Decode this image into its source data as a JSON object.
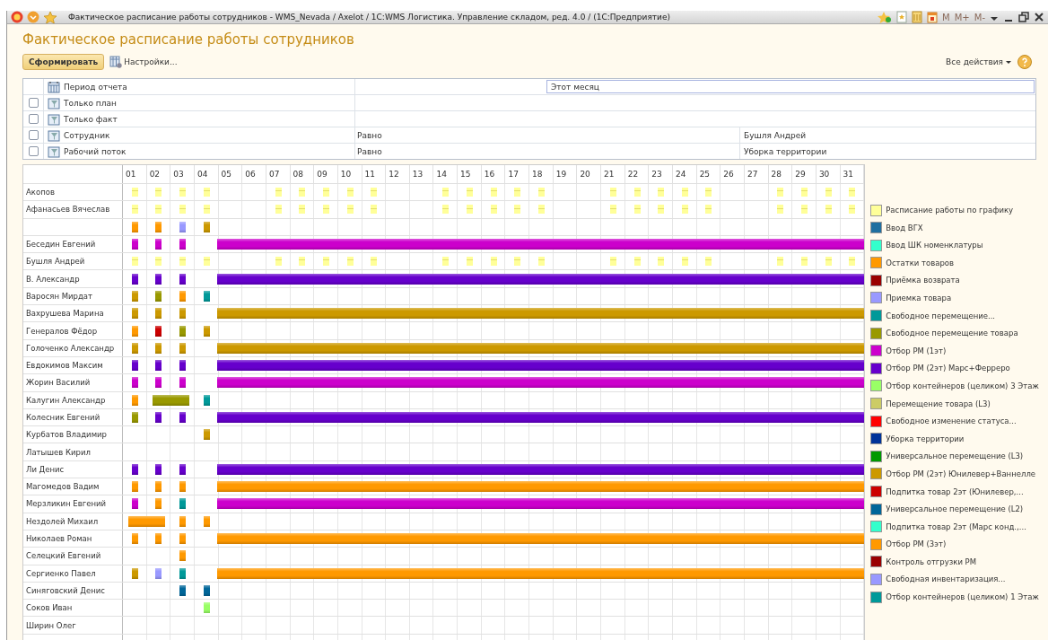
{
  "title_bar": {
    "title": "Фактическое расписание работы сотрудников - WMS_Nevada / Axelot /  1С:WMS Логистика. Управление складом, ред. 4.0 /  (1С:Предприятие)",
    "memory_keys": [
      "M",
      "M+",
      "M-"
    ]
  },
  "heading": "Фактическое расписание работы сотрудников",
  "toolbar": {
    "primary_button": "Сформировать",
    "settings_button": "Настройки...",
    "all_actions": "Все действия"
  },
  "filters": [
    {
      "label": "Период отчета",
      "kind": "period",
      "value": "Этот месяц"
    },
    {
      "label": "Только план",
      "kind": "flag",
      "checked": false
    },
    {
      "label": "Только факт",
      "kind": "flag",
      "checked": false
    },
    {
      "label": "Сотрудник",
      "kind": "condition",
      "checked": false,
      "condition": "Равно",
      "value": "Бушля Андрей"
    },
    {
      "label": "Рабочий поток",
      "kind": "condition",
      "checked": false,
      "condition": "Равно",
      "value": "Уборка территории"
    }
  ],
  "timeline": {
    "days": [
      "01",
      "02",
      "03",
      "04",
      "05",
      "06",
      "07",
      "08",
      "09",
      "10",
      "11",
      "12",
      "13",
      "14",
      "15",
      "16",
      "17",
      "18",
      "19",
      "20",
      "21",
      "22",
      "23",
      "24",
      "25",
      "26",
      "27",
      "28",
      "29",
      "30",
      "31"
    ],
    "rows": [
      {
        "name": "Акопов",
        "kind": "plan",
        "cells": [
          {
            "color": "#ffff99",
            "kind": "block"
          },
          {
            "color": "#ffff99",
            "kind": "block"
          },
          {
            "color": "#ffff99",
            "kind": "block"
          },
          {
            "color": "#ffff99",
            "kind": "block"
          },
          null,
          null,
          {
            "color": "#ffff99",
            "kind": "block"
          },
          {
            "color": "#ffff99",
            "kind": "block"
          },
          {
            "color": "#ffff99",
            "kind": "block"
          },
          {
            "color": "#ffff99",
            "kind": "block"
          },
          {
            "color": "#ffff99",
            "kind": "block"
          },
          null,
          null,
          {
            "color": "#ffff99",
            "kind": "block"
          },
          {
            "color": "#ffff99",
            "kind": "block"
          },
          {
            "color": "#ffff99",
            "kind": "block"
          },
          {
            "color": "#ffff99",
            "kind": "block"
          },
          {
            "color": "#ffff99",
            "kind": "block"
          },
          null,
          null,
          {
            "color": "#ffff99",
            "kind": "block"
          },
          {
            "color": "#ffff99",
            "kind": "block"
          },
          {
            "color": "#ffff99",
            "kind": "block"
          },
          {
            "color": "#ffff99",
            "kind": "block"
          },
          {
            "color": "#ffff99",
            "kind": "block"
          },
          null,
          null,
          {
            "color": "#ffff99",
            "kind": "block"
          },
          {
            "color": "#ffff99",
            "kind": "block"
          },
          {
            "color": "#ffff99",
            "kind": "block"
          },
          {
            "color": "#ffff99",
            "kind": "block"
          }
        ]
      },
      {
        "name": "Афанасьев Вячеслав",
        "kind": "plan",
        "cells": [
          {
            "color": "#ffff99",
            "kind": "block"
          },
          {
            "color": "#ffff99",
            "kind": "block"
          },
          {
            "color": "#ffff99",
            "kind": "block"
          },
          {
            "color": "#ffff99",
            "kind": "block"
          },
          null,
          null,
          {
            "color": "#ffff99",
            "kind": "block"
          },
          {
            "color": "#ffff99",
            "kind": "block"
          },
          {
            "color": "#ffff99",
            "kind": "block"
          },
          {
            "color": "#ffff99",
            "kind": "block"
          },
          {
            "color": "#ffff99",
            "kind": "block"
          },
          null,
          null,
          {
            "color": "#ffff99",
            "kind": "block"
          },
          {
            "color": "#ffff99",
            "kind": "block"
          },
          {
            "color": "#ffff99",
            "kind": "block"
          },
          {
            "color": "#ffff99",
            "kind": "block"
          },
          {
            "color": "#ffff99",
            "kind": "block"
          },
          null,
          null,
          {
            "color": "#ffff99",
            "kind": "block"
          },
          {
            "color": "#ffff99",
            "kind": "block"
          },
          {
            "color": "#ffff99",
            "kind": "block"
          },
          {
            "color": "#ffff99",
            "kind": "block"
          },
          {
            "color": "#ffff99",
            "kind": "block"
          },
          null,
          null,
          {
            "color": "#ffff99",
            "kind": "block"
          },
          {
            "color": "#ffff99",
            "kind": "block"
          },
          {
            "color": "#ffff99",
            "kind": "block"
          },
          {
            "color": "#ffff99",
            "kind": "block"
          }
        ]
      },
      {
        "kind": "fact",
        "cells": [
          {
            "color": "#ff9900",
            "kind": "block"
          },
          {
            "color": "#ff9900",
            "kind": "block"
          },
          {
            "color": "#9999ff",
            "kind": "block"
          },
          {
            "color": "#cc9900",
            "kind": "block"
          }
        ]
      },
      {
        "name": "Беседин Евгений",
        "kind": "fact",
        "cells": [
          {
            "color": "#cc00cc",
            "kind": "block"
          },
          {
            "color": "#cc00cc",
            "kind": "block"
          },
          {
            "color": "#cc00cc",
            "kind": "block"
          },
          null,
          {
            "color": "#cc00cc",
            "kind": "to_month_end"
          }
        ]
      },
      {
        "name": "Бушля Андрей",
        "kind": "plan",
        "cells": [
          {
            "color": "#ffff99",
            "kind": "block"
          },
          {
            "color": "#ffff99",
            "kind": "block"
          },
          {
            "color": "#ffff99",
            "kind": "block"
          },
          {
            "color": "#ffff99",
            "kind": "block"
          },
          null,
          null,
          {
            "color": "#ffff99",
            "kind": "block"
          },
          {
            "color": "#ffff99",
            "kind": "block"
          },
          {
            "color": "#ffff99",
            "kind": "block"
          },
          {
            "color": "#ffff99",
            "kind": "block"
          },
          {
            "color": "#ffff99",
            "kind": "block"
          },
          null,
          null,
          {
            "color": "#ffff99",
            "kind": "block"
          },
          {
            "color": "#ffff99",
            "kind": "block"
          },
          {
            "color": "#ffff99",
            "kind": "block"
          },
          {
            "color": "#ffff99",
            "kind": "block"
          },
          {
            "color": "#ffff99",
            "kind": "block"
          },
          null,
          null,
          {
            "color": "#ffff99",
            "kind": "block"
          },
          {
            "color": "#ffff99",
            "kind": "block"
          },
          {
            "color": "#ffff99",
            "kind": "block"
          },
          {
            "color": "#ffff99",
            "kind": "block"
          },
          {
            "color": "#ffff99",
            "kind": "block"
          },
          null,
          null,
          {
            "color": "#ffff99",
            "kind": "block"
          },
          {
            "color": "#ffff99",
            "kind": "block"
          },
          {
            "color": "#ffff99",
            "kind": "block"
          },
          {
            "color": "#ffff99",
            "kind": "block"
          }
        ]
      },
      {
        "name": "В. Александр",
        "kind": "fact",
        "cells": [
          {
            "color": "#6600cc",
            "kind": "block"
          },
          {
            "color": "#6600cc",
            "kind": "block"
          },
          {
            "color": "#6600cc",
            "kind": "block"
          },
          null,
          {
            "color": "#6600cc",
            "kind": "to_month_end"
          }
        ]
      },
      {
        "name": "Варосян Мирдат",
        "kind": "fact",
        "cells": [
          {
            "color": "#cc9900",
            "kind": "block"
          },
          {
            "color": "#999900",
            "kind": "block"
          },
          {
            "color": "#ff9900",
            "kind": "block"
          },
          {
            "color": "#009999",
            "kind": "block"
          }
        ]
      },
      {
        "name": "Вахрушева Марина",
        "kind": "fact",
        "cells": [
          {
            "color": "#cc9900",
            "kind": "block"
          },
          {
            "color": "#cc9900",
            "kind": "block"
          },
          {
            "color": "#cc9900",
            "kind": "block"
          },
          null,
          {
            "color": "#cc9900",
            "kind": "to_month_end"
          }
        ]
      },
      {
        "name": "Генералов Фёдор",
        "kind": "fact",
        "cells": [
          {
            "color": "#ff9900",
            "kind": "block"
          },
          {
            "color": "#cc0000",
            "kind": "block"
          },
          {
            "color": "#999900",
            "kind": "block"
          },
          {
            "color": "#cc9900",
            "kind": "block"
          }
        ]
      },
      {
        "name": "Голоченко Александр",
        "kind": "fact",
        "cells": [
          {
            "color": "#cc9900",
            "kind": "block"
          },
          {
            "color": "#cc9900",
            "kind": "block"
          },
          {
            "color": "#cc9900",
            "kind": "block"
          },
          null,
          {
            "color": "#cc9900",
            "kind": "to_month_end"
          }
        ]
      },
      {
        "name": "Евдокимов Максим",
        "kind": "fact",
        "cells": [
          {
            "color": "#6600cc",
            "kind": "block"
          },
          {
            "color": "#6600cc",
            "kind": "block"
          },
          {
            "color": "#6600cc",
            "kind": "block"
          },
          null,
          {
            "color": "#6600cc",
            "kind": "to_month_end"
          }
        ]
      },
      {
        "name": "Жорин Василий",
        "kind": "fact",
        "cells": [
          {
            "color": "#cc00cc",
            "kind": "block"
          },
          {
            "color": "#cc00cc",
            "kind": "block"
          },
          {
            "color": "#cc00cc",
            "kind": "block"
          },
          null,
          {
            "color": "#cc00cc",
            "kind": "to_month_end"
          }
        ]
      },
      {
        "name": "Калугин Александр",
        "kind": "fact",
        "cells": [
          {
            "color": "#ff9900",
            "kind": "block"
          },
          {
            "color": "#999900",
            "kind": "two_days"
          },
          null,
          {
            "color": "#009999",
            "kind": "block"
          }
        ]
      },
      {
        "name": "Колесник Евгений",
        "kind": "fact",
        "cells": [
          {
            "color": "#999900",
            "kind": "block"
          },
          {
            "color": "#6600cc",
            "kind": "block"
          },
          {
            "color": "#6600cc",
            "kind": "block"
          },
          null,
          {
            "color": "#6600cc",
            "kind": "to_month_end"
          }
        ]
      },
      {
        "name": "Курбатов Владимир",
        "kind": "fact",
        "cells": [
          null,
          null,
          null,
          {
            "color": "#cc9900",
            "kind": "block"
          }
        ]
      },
      {
        "name": "Латышев Кирил",
        "kind": "fact"
      },
      {
        "name": "Ли Денис",
        "kind": "fact",
        "cells": [
          {
            "color": "#6600cc",
            "kind": "block"
          },
          {
            "color": "#6600cc",
            "kind": "block"
          },
          {
            "color": "#6600cc",
            "kind": "block"
          },
          null,
          {
            "color": "#6600cc",
            "kind": "to_month_end"
          }
        ]
      },
      {
        "name": "Магомедов Вадим",
        "kind": "fact",
        "cells": [
          {
            "color": "#ff9900",
            "kind": "block"
          },
          {
            "color": "#ff9900",
            "kind": "block"
          },
          {
            "color": "#ff9900",
            "kind": "block"
          },
          null,
          {
            "color": "#ff9900",
            "kind": "to_month_end"
          }
        ]
      },
      {
        "name": "Мерзликин Евгений",
        "kind": "fact",
        "cells": [
          {
            "color": "#cc00cc",
            "kind": "block"
          },
          {
            "color": "#ff9900",
            "kind": "block"
          },
          {
            "color": "#009999",
            "kind": "block"
          },
          null,
          {
            "color": "#cc00cc",
            "kind": "to_month_end"
          }
        ]
      },
      {
        "name": "Нездолей Михаил",
        "kind": "fact",
        "cells": [
          {
            "color": "#ff9900",
            "kind": "two_days"
          },
          null,
          {
            "color": "#ff9900",
            "kind": "block"
          },
          {
            "color": "#ff9900",
            "kind": "block"
          }
        ]
      },
      {
        "name": "Николаев Роман",
        "kind": "fact",
        "cells": [
          {
            "color": "#ff9900",
            "kind": "block"
          },
          {
            "color": "#ff9900",
            "kind": "block"
          },
          {
            "color": "#ff9900",
            "kind": "block"
          },
          null,
          {
            "color": "#ff9900",
            "kind": "to_month_end"
          }
        ]
      },
      {
        "name": "Селецкий Евгений",
        "kind": "fact",
        "cells": [
          null,
          null,
          {
            "color": "#ff9900",
            "kind": "block"
          }
        ]
      },
      {
        "name": "Сергиенко Павел",
        "kind": "fact",
        "cells": [
          {
            "color": "#cc9900",
            "kind": "block"
          },
          {
            "color": "#9999ff",
            "kind": "block"
          },
          {
            "color": "#009999",
            "kind": "block"
          },
          null,
          {
            "color": "#ff9900",
            "kind": "to_month_end"
          }
        ]
      },
      {
        "name": "Синяговский Денис",
        "kind": "fact",
        "cells": [
          null,
          null,
          {
            "color": "#006699",
            "kind": "block"
          },
          {
            "color": "#006699",
            "kind": "block"
          }
        ]
      },
      {
        "name": "Соков Иван",
        "kind": "fact",
        "cells": [
          null,
          null,
          null,
          {
            "color": "#99ff66",
            "kind": "block"
          }
        ]
      },
      {
        "name": "Ширин Олег",
        "kind": "fact"
      }
    ]
  },
  "legend": [
    {
      "label": "Расписание работы по графику",
      "color": "#ffff99"
    },
    {
      "label": "Ввод ВГХ",
      "color": "#1f6fa0"
    },
    {
      "label": "Ввод ШК номенклатуры",
      "color": "#33ffcc"
    },
    {
      "label": "Остатки товаров",
      "color": "#ff9900"
    },
    {
      "label": "Приёмка возврата",
      "color": "#990000"
    },
    {
      "label": "Приемка товара",
      "color": "#9999ff"
    },
    {
      "label": "Свободное  перемещение...",
      "color": "#009999"
    },
    {
      "label": "Свободное перемещение товара",
      "color": "#999900"
    },
    {
      "label": "Отбор РМ (1эт)",
      "color": "#cc00cc"
    },
    {
      "label": "Отбор РМ (2эт) Марс+Ферреро",
      "color": "#6600cc"
    },
    {
      "label": "Отбор контейнеров (целиком) 3 Этаж",
      "color": "#99ff66"
    },
    {
      "label": "Перемещение товара (L3)",
      "color": "#cccc66"
    },
    {
      "label": "Свободное  изменение  статуса...",
      "color": "#ff0000"
    },
    {
      "label": "Уборка территории",
      "color": "#003399"
    },
    {
      "label": "Универсальное перемещение (L3)",
      "color": "#009900"
    },
    {
      "label": "Отбор РМ (2эт) Юнилевер+Ваннелле",
      "color": "#cc9900"
    },
    {
      "label": "Подпитка  товар  2эт (Юнилевер,...",
      "color": "#cc0000"
    },
    {
      "label": "Универсальное перемещение (L2)",
      "color": "#006699"
    },
    {
      "label": "Подпитка товар  2эт (Марс  конд.,...",
      "color": "#33ffcc"
    },
    {
      "label": "Отбор РМ (3эт)",
      "color": "#ff9900"
    },
    {
      "label": "Контроль отгрузки РМ",
      "color": "#990000"
    },
    {
      "label": "Свободная  инвентаризация...",
      "color": "#9999ff"
    },
    {
      "label": "Отбор контейнеров (целиком) 1 Этаж",
      "color": "#009999"
    }
  ]
}
